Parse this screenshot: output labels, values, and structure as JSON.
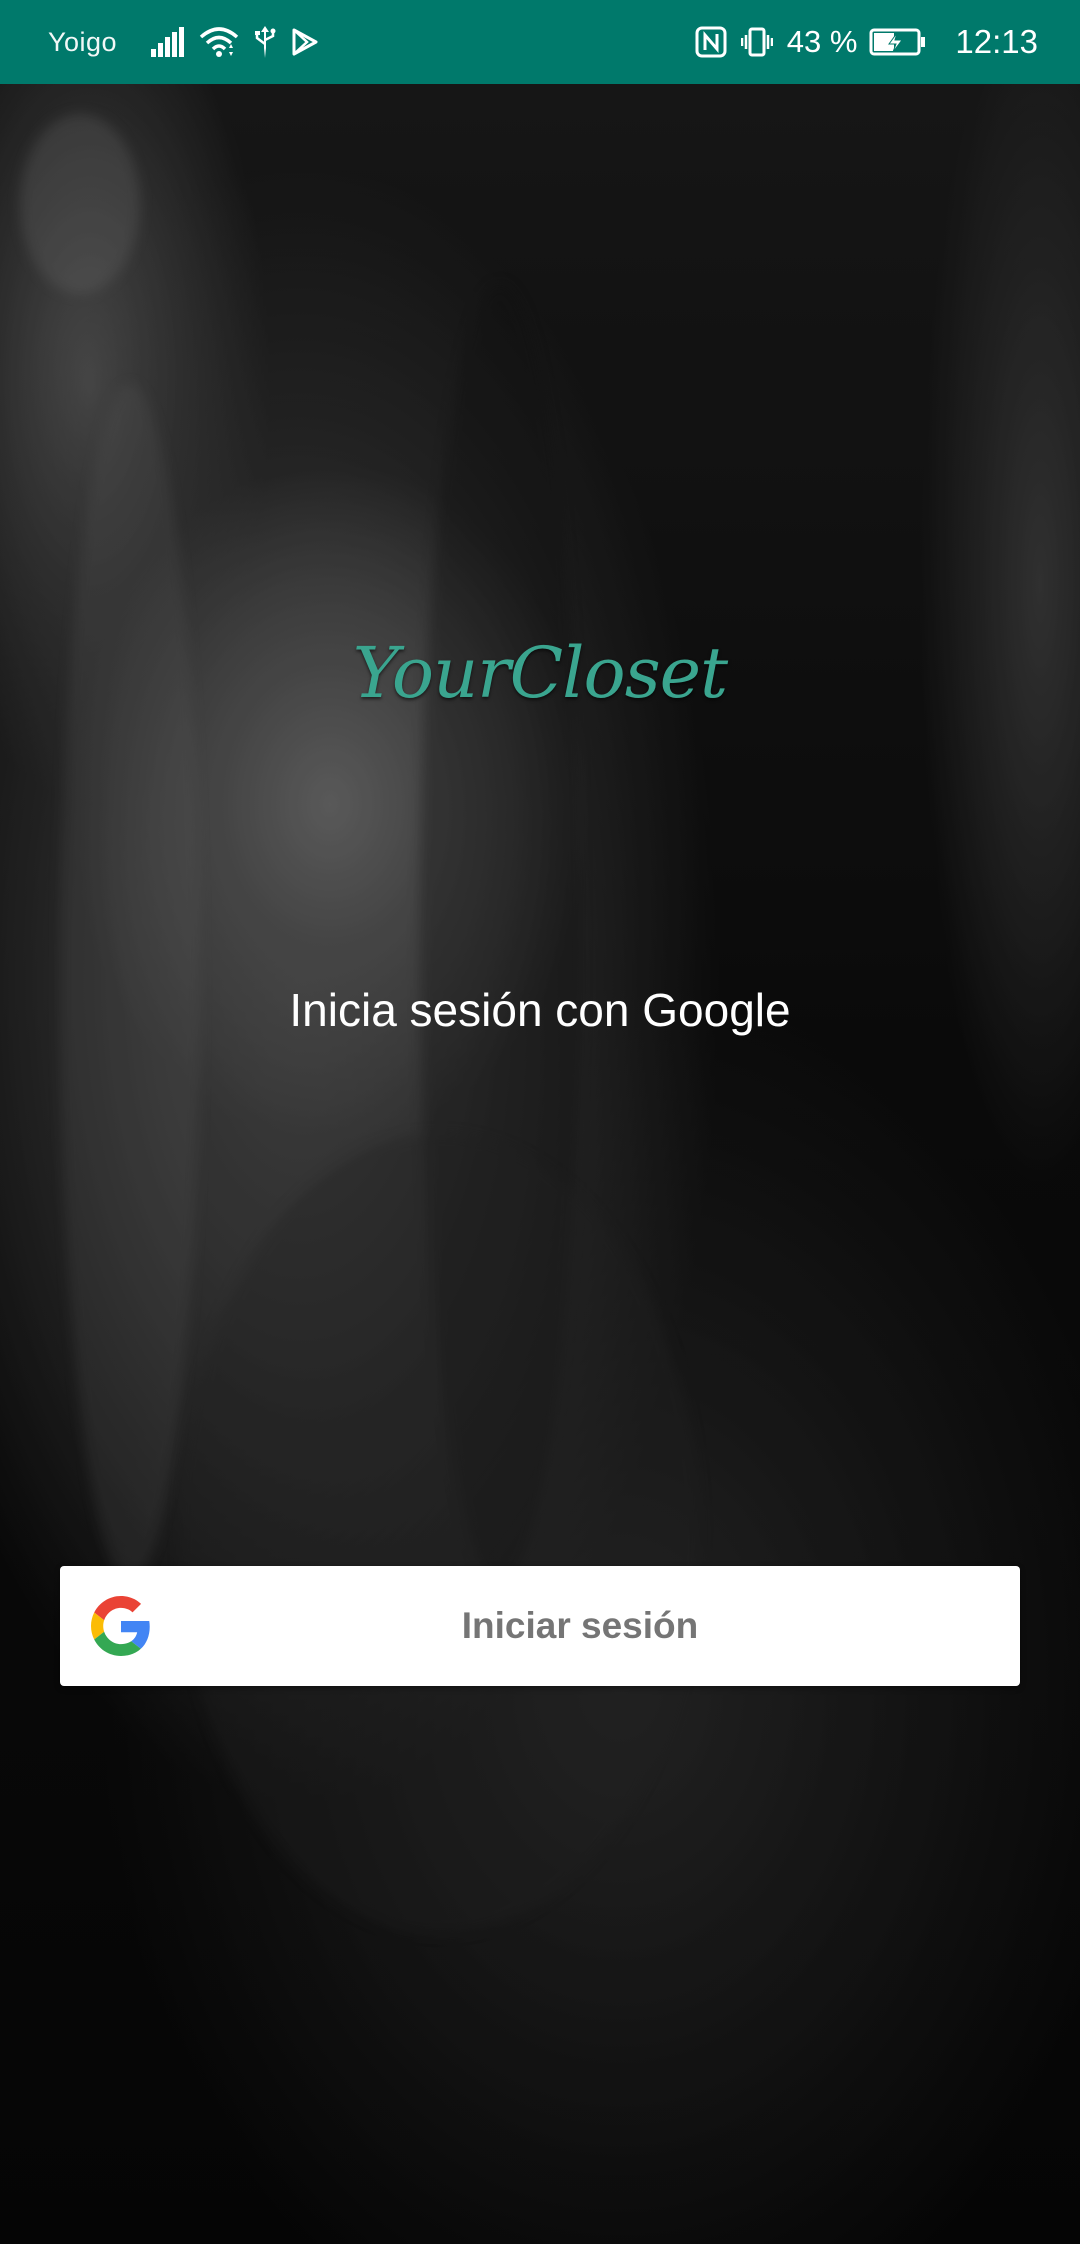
{
  "status_bar": {
    "carrier": "Yoigo",
    "battery_percent": "43 %",
    "time": "12:13",
    "background_color": "#00796b",
    "icons": [
      "signal-icon",
      "wifi-icon",
      "usb-icon",
      "play-store-icon",
      "nfc-icon",
      "vibrate-icon",
      "battery-charging-icon"
    ]
  },
  "app": {
    "logo_text": "YourCloset",
    "logo_color": "#3aa58f"
  },
  "login": {
    "heading": "Inicia sesión con Google",
    "button_label": "Iniciar sesión",
    "button_icon": "google-icon"
  }
}
